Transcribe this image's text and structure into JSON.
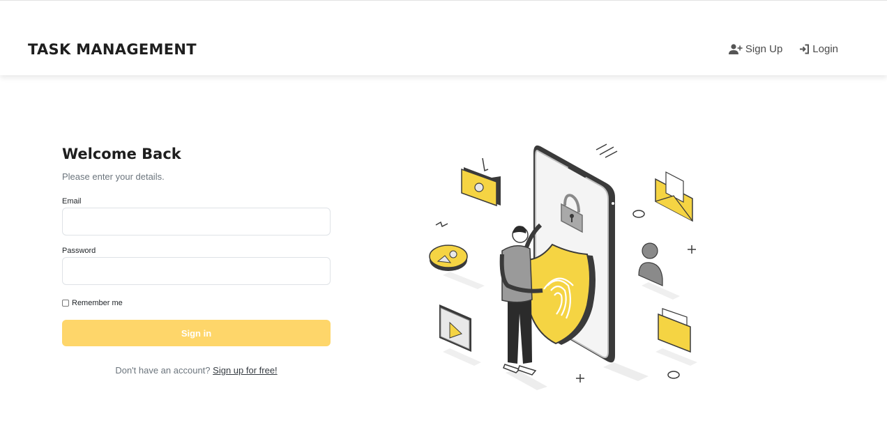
{
  "header": {
    "brand": "TASK MANAGEMENT",
    "nav": {
      "signup_label": "Sign Up",
      "login_label": "Login"
    }
  },
  "form": {
    "title": "Welcome Back",
    "subtitle": "Please enter your details.",
    "email_label": "Email",
    "email_value": "",
    "password_label": "Password",
    "password_value": "",
    "remember_label": "Remember me",
    "remember_checked": false,
    "submit_label": "Sign in",
    "signup_prompt": "Don't have an account?",
    "signup_link": "Sign up for free!"
  },
  "illustration": {
    "icons": [
      "folder-icon",
      "padlock-icon",
      "envelope-icon",
      "shield-fingerprint-icon",
      "user-icon",
      "video-icon",
      "documents-folder-icon"
    ]
  },
  "colors": {
    "accent_yellow": "#FFD24C",
    "button_yellow": "#FED66A",
    "text_dark": "#1E1E1E",
    "text_muted": "#6C757D"
  }
}
